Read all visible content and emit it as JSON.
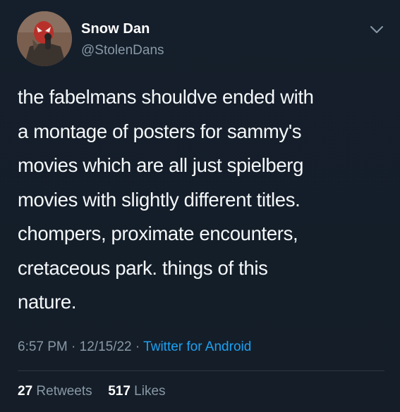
{
  "author": {
    "display_name": "Snow Dan",
    "handle": "@StolenDans",
    "avatar": "avatar-photo"
  },
  "tweet": {
    "lines": [
      "the fabelmans shouldve ended with",
      "a montage of posters for sammy's",
      "movies which are all just spielberg",
      "movies with slightly different titles.",
      "chompers, proximate encounters,",
      "cretaceous park. things of this",
      "nature."
    ],
    "time": "6:57 PM",
    "date": "12/15/22",
    "separator": "·",
    "source": "Twitter for Android"
  },
  "stats": {
    "retweets_count": "27",
    "retweets_label": "Retweets",
    "likes_count": "517",
    "likes_label": "Likes"
  },
  "icons": {
    "more_menu": "chevron-down-icon"
  },
  "colors": {
    "background": "#15202b",
    "secondary_text": "#8899a6",
    "link": "#1da1f2"
  }
}
